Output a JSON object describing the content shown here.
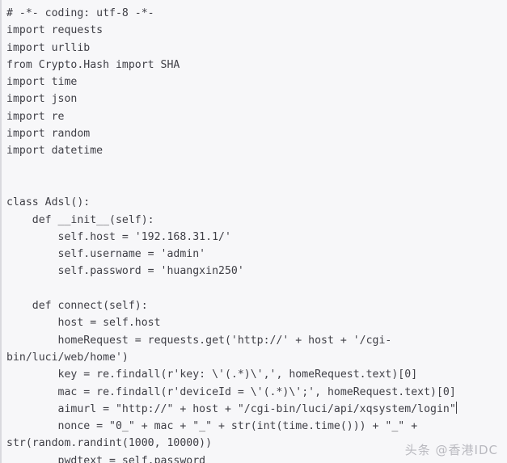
{
  "editor": {
    "language": "python",
    "background_color": "#f7f7f9",
    "text_color": "#3f3f46",
    "gutter_rule_color": "#d9d9de",
    "caret_visible": true,
    "lines": [
      "# -*- coding: utf-8 -*-",
      "import requests",
      "import urllib",
      "from Crypto.Hash import SHA",
      "import time",
      "import json",
      "import re",
      "import random",
      "import datetime",
      "",
      "",
      "class Adsl():",
      "    def __init__(self):",
      "        self.host = '192.168.31.1/'",
      "        self.username = 'admin'",
      "        self.password = 'huangxin250'",
      "",
      "    def connect(self):",
      "        host = self.host",
      "        homeRequest = requests.get('http://' + host + '/cgi-",
      "bin/luci/web/home')",
      "        key = re.findall(r'key: \\'(.*)\\',', homeRequest.text)[0]",
      "        mac = re.findall(r'deviceId = \\'(.*)\\';', homeRequest.text)[0]",
      "        aimurl = \"http://\" + host + \"/cgi-bin/luci/api/xqsystem/login\"",
      "        nonce = \"0_\" + mac + \"_\" + str(int(time.time())) + \"_\" +",
      "str(random.randint(1000, 10000))",
      "        pwdtext = self.password"
    ],
    "caret_line_index": 23
  },
  "watermark": {
    "text": "头条 @香港IDC",
    "color": "#b9b9bf"
  }
}
